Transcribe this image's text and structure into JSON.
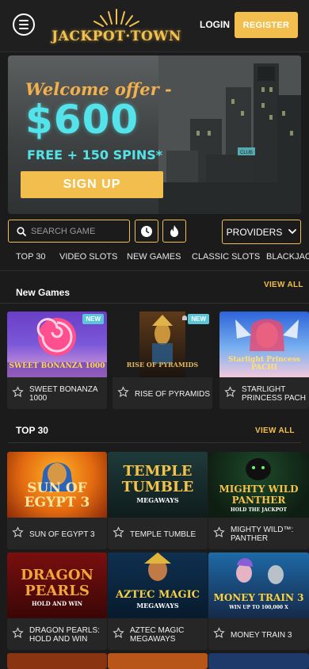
{
  "header": {
    "brand": "JACKPOT·TOWN",
    "login_label": "LOGIN",
    "register_label": "REGISTER"
  },
  "hero": {
    "welcome": "Welcome offer -",
    "amount": "$600",
    "spins": "FREE + 150 SPINS*",
    "cta": "SIGN UP",
    "sign_text": "CLUB"
  },
  "search": {
    "placeholder": "SEARCH GAME",
    "providers_label": "PROVIDERS"
  },
  "tabs": [
    "TOP 30",
    "VIDEO SLOTS",
    "NEW GAMES",
    "CLASSIC SLOTS",
    "BLACKJACK"
  ],
  "sections": {
    "new_games": {
      "title": "New Games",
      "view_all": "VIEW ALL"
    },
    "top30": {
      "title": "TOP 30",
      "view_all": "VIEW ALL"
    }
  },
  "badges": {
    "new": "NEW"
  },
  "new_games": [
    {
      "name": "SWEET BONANZA 1000",
      "art": "SWEET BONANZA 1000"
    },
    {
      "name": "RISE OF PYRAMIDS",
      "art": "RISE OF PYRAMIDS"
    },
    {
      "name": "STARLIGHT PRINCESS PACH",
      "art": "Starlight Princess PACHI"
    }
  ],
  "top30_games": [
    {
      "name": "SUN OF EGYPT 3",
      "art_line1": "SUN OF",
      "art_line2": "EGYPT 3"
    },
    {
      "name": "TEMPLE TUMBLE",
      "art_line1": "TEMPLE",
      "art_line2": "TUMBLE",
      "art_sub": "MEGAWAYS"
    },
    {
      "name": "MIGHTY WILD™: PANTHER",
      "art_line1": "MIGHTY WILD",
      "art_line2": "PANTHER",
      "art_sub": "HOLD THE JACKPOT"
    },
    {
      "name": "DRAGON PEARLS: HOLD AND WIN",
      "art_line1": "DRAGON",
      "art_line2": "PEARLS",
      "art_sub": "HOLD AND WIN"
    },
    {
      "name": "AZTEC MAGIC MEGAWAYS",
      "art_line1": "AZTEC MAGIC",
      "art_line2": "MEGAWAYS"
    },
    {
      "name": "MONEY TRAIN 3",
      "art_line1": "MONEY TRAIN 3",
      "art_sub": "WIN UP TO 100,000 X"
    }
  ],
  "colors": {
    "accent": "#f2bf4e",
    "teal": "#54e3ea",
    "background": "#1b1b1b",
    "card": "#262626",
    "badge": "#5cc6d8"
  },
  "icons": [
    "hamburger-menu-icon",
    "search-icon",
    "clock-icon",
    "fire-icon",
    "chevron-down-icon",
    "star-icon"
  ]
}
